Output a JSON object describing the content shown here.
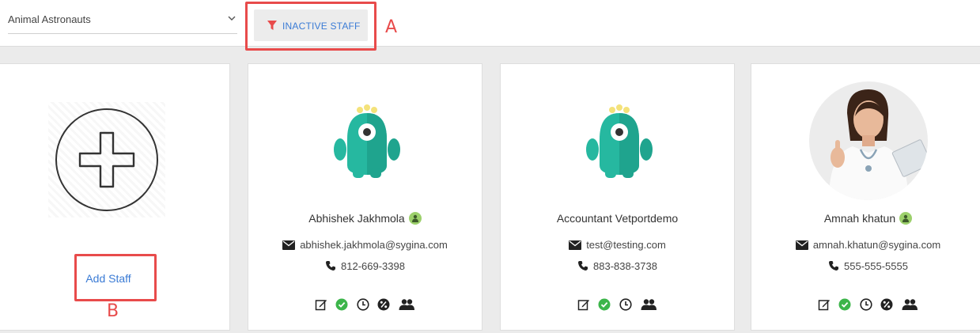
{
  "toolbar": {
    "clinic_select": {
      "value": "Animal Astronauts",
      "icon": "chevron-down-icon"
    },
    "filter_button": {
      "label": "INACTIVE STAFF",
      "icon": "filter-icon",
      "icon_color": "#e84b4b"
    }
  },
  "annotations": {
    "marker_a": "A",
    "marker_b": "B",
    "color": "#e84b4b"
  },
  "add_card": {
    "label": "Add Staff",
    "icon": "add-circle-icon"
  },
  "staff": [
    {
      "name": "Abhishek Jakhmola",
      "has_role_badge": true,
      "email": "abhishek.jakhmola@sygina.com",
      "phone": "812-669-3398",
      "avatar": "monster-avatar",
      "actions": [
        "edit-icon",
        "active-check-icon",
        "clock-icon",
        "percent-icon",
        "group-icon"
      ]
    },
    {
      "name": "Accountant Vetportdemo",
      "has_role_badge": false,
      "email": "test@testing.com",
      "phone": "883-838-3738",
      "avatar": "monster-avatar",
      "actions": [
        "edit-icon",
        "active-check-icon",
        "clock-icon",
        "group-icon"
      ]
    },
    {
      "name": "Amnah khatun",
      "has_role_badge": true,
      "email": "amnah.khatun@sygina.com",
      "phone": "555-555-5555",
      "avatar": "photo-avatar",
      "actions": [
        "edit-icon",
        "active-check-icon",
        "clock-icon",
        "percent-icon",
        "group-icon"
      ]
    }
  ],
  "colors": {
    "accent": "#3a7bd5",
    "success": "#3cb54a",
    "role_badge": "#9cd06b",
    "monster": "#26b8a0"
  }
}
